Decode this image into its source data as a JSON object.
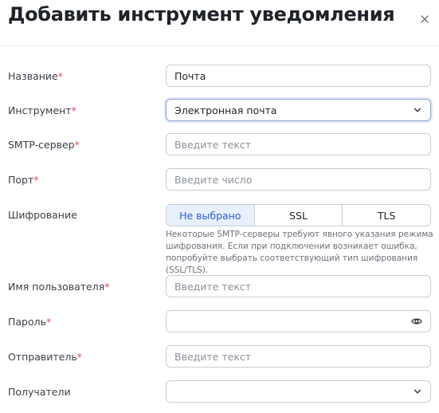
{
  "dialog": {
    "title": "Добавить инструмент уведомления",
    "close_icon": "close-icon"
  },
  "form": {
    "name": {
      "label": "Название",
      "required_mark": "*",
      "value": "Почта"
    },
    "tool": {
      "label": "Инструмент",
      "required_mark": "*",
      "selected": "Электронная почта"
    },
    "smtp_server": {
      "label": "SMTP-сервер",
      "required_mark": "*",
      "placeholder": "Введите текст"
    },
    "port": {
      "label": "Порт",
      "required_mark": "*",
      "placeholder": "Введите число"
    },
    "encryption": {
      "label": "Шифрование",
      "options": [
        "Не выбрано",
        "SSL",
        "TLS"
      ],
      "selected_index": 0,
      "hint": "Некоторые SMTP-серверы требуют явного указания режима шифрования. Если при подключении возникает ошибка, попробуйте выбрать соответствующий тип шифрования (SSL/TLS)."
    },
    "username": {
      "label": "Имя пользователя",
      "required_mark": "*",
      "placeholder": "Введите текст"
    },
    "password": {
      "label": "Пароль",
      "required_mark": "*",
      "value": "",
      "toggle_icon": "eye-icon"
    },
    "sender": {
      "label": "Отправитель",
      "required_mark": "*",
      "placeholder": "Введите текст"
    },
    "recipients": {
      "label": "Получатели",
      "selected": ""
    }
  },
  "colors": {
    "required": "#e5484d",
    "accent": "#2e5fd0",
    "active_segment_bg": "#e8effd",
    "border": "#c9cdd4"
  }
}
